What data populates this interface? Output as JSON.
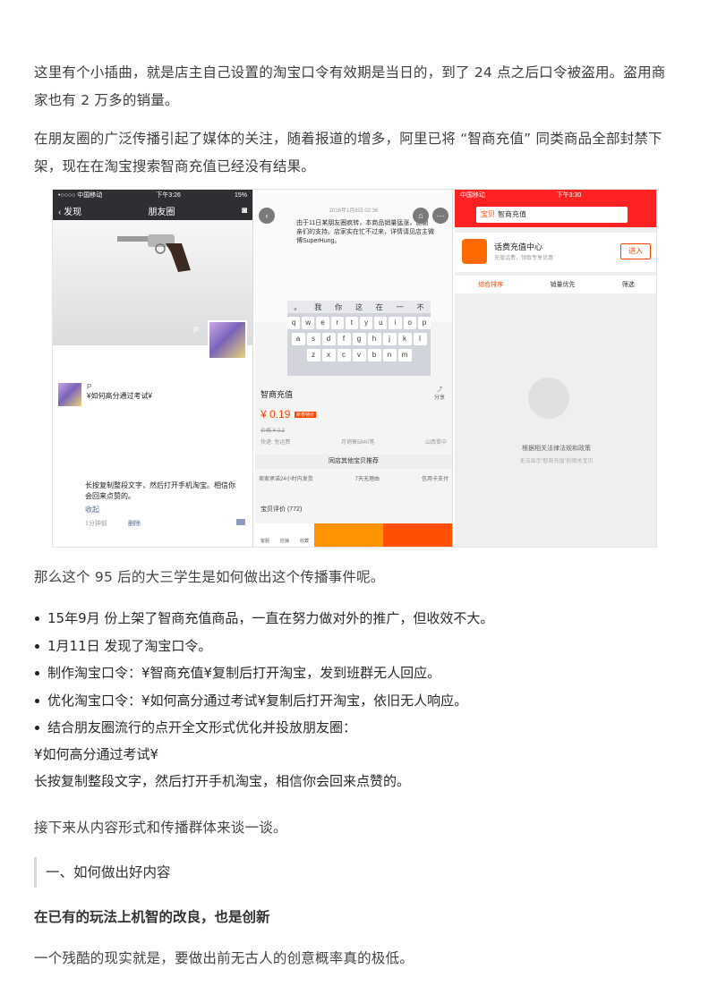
{
  "paragraphs": {
    "p1": "这里有个小插曲，就是店主自己设置的淘宝口令有效期是当日的，到了 24 点之后口令被盗用。盗用商家也有 2 万多的销量。",
    "p2": "在朋友圈的广泛传播引起了媒体的关注，随着报道的增多，阿里已将 “智商充值” 同类商品全部封禁下架，现在在淘宝搜索智商充值已经没有结果。",
    "p3": "那么这个 95 后的大三学生是如何做出这个传播事件呢。",
    "p4": "接下来从内容形式和传播群体来谈一谈。",
    "p5": "一个残酷的现实就是，要做出前无古人的创意概率真的极低。"
  },
  "bullets": [
    "15年9月 份上架了智商充值商品，一直在努力做对外的推广，但收效不大。",
    "1月11日 发现了淘宝口令。",
    "制作淘宝口令：¥智商充值¥复制后打开淘宝，发到班群无人回应。",
    "优化淘宝口令：¥如何高分通过考试¥复制后打开淘宝，依旧无人响应。",
    "结合朋友圈流行的点开全文形式优化并投放朋友圈："
  ],
  "quote_lines": [
    "¥如何高分通过考试¥",
    "长按复制整段文字，然后打开手机淘宝，相信你会回来点赞的。"
  ],
  "section_heading": "一、如何做出好内容",
  "sub_heading": "在已有的玩法上机智的改良，也是创新",
  "screenshots": {
    "wechat": {
      "carrier": "•○○○○ 中国移动",
      "time": "下午3:26",
      "battery": "15%",
      "back": "发现",
      "title": "朋友圈",
      "cover_name": "P",
      "post_name": "P",
      "post_line": "¥如何高分通过考试¥",
      "post_body": "长按复制整段文字，然后打开手机淘宝。相信你会回来点赞的。",
      "more": "收起",
      "time_ago": "1分钟前",
      "delete": "删除"
    },
    "taobao_item": {
      "date": "2016年1月8日 02:36",
      "message": "由于11日某朋友圈疯转，本商品销量猛涨，谢谢亲们的支持。店家实在忙不过来，详情请见店主微博SuperHung。",
      "candidates": [
        "。",
        "我",
        "你",
        "这",
        "在",
        "一",
        "不"
      ],
      "row1": [
        "q",
        "w",
        "e",
        "r",
        "t",
        "y",
        "u",
        "i",
        "o",
        "p"
      ],
      "row2": [
        "a",
        "s",
        "d",
        "f",
        "g",
        "h",
        "j",
        "k",
        "l"
      ],
      "row3": [
        "z",
        "x",
        "c",
        "v",
        "b",
        "n",
        "m"
      ],
      "title": "智商充值",
      "share": "分享",
      "price": "¥ 0.19",
      "price_tag": "新春特价",
      "old_price": "价格 ¥ 0.2",
      "ship_fee": "快递: 免运费",
      "sold": "月销售5840笔",
      "location": "山西晋中",
      "recommend": "同店其他宝贝推荐",
      "guarantees": [
        "卖家承诺24小时内发货",
        "7天无理由",
        "信用卡支付"
      ],
      "review": "宝贝评价 (772)",
      "bar": [
        "客服",
        "店铺",
        "收藏"
      ]
    },
    "taobao_search": {
      "carrier": "中国移动",
      "time": "下午3:30",
      "search_tag": "宝贝",
      "query": "智商充值",
      "card_title": "话费充值中心",
      "card_sub": "充值话费，领取专享优惠",
      "card_btn": "进入",
      "sort": [
        "综合排序",
        "销量优先",
        "筛选"
      ],
      "empty_1": "根据相关法律法规和政策",
      "empty_2": "无法显示“智商充值”的相关宝贝"
    }
  }
}
